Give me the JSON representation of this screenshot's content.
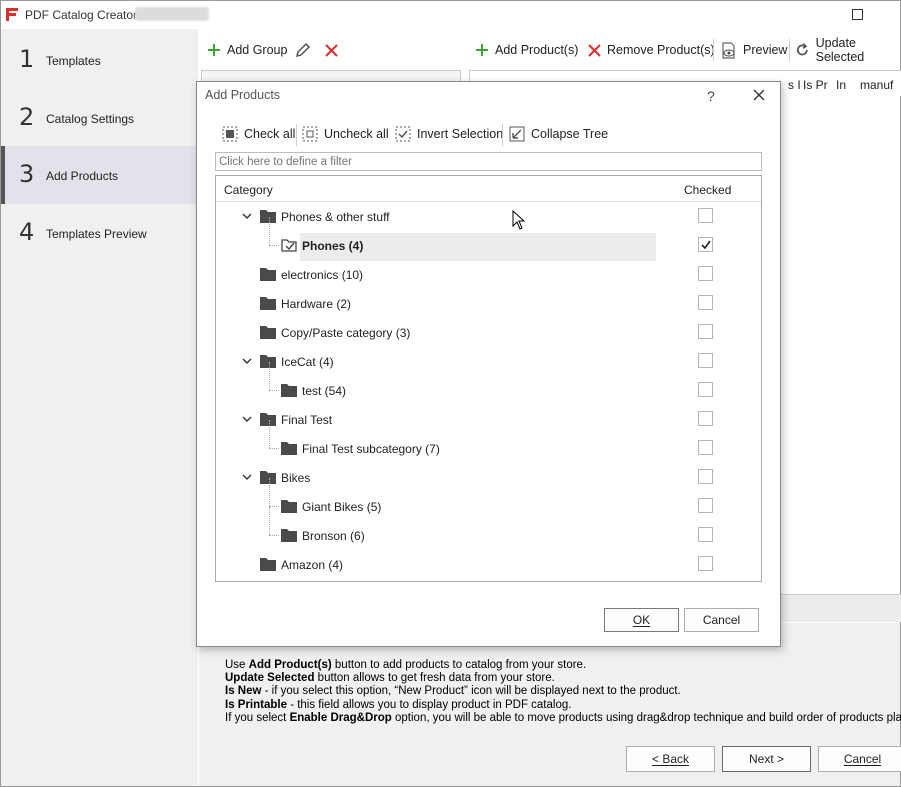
{
  "app": {
    "title": "PDF Catalog Creator"
  },
  "sidebar": {
    "items": [
      {
        "num": "1",
        "label": "Templates"
      },
      {
        "num": "2",
        "label": "Catalog Settings"
      },
      {
        "num": "3",
        "label": "Add Products"
      },
      {
        "num": "4",
        "label": "Templates Preview"
      }
    ],
    "active_index": 2
  },
  "toolbar": {
    "add_group": "Add Group",
    "add_products": "Add Product(s)",
    "remove_products": "Remove Product(s)",
    "preview": "Preview",
    "update_selected": "Update Selected"
  },
  "grid": {
    "columns": [
      "s I",
      "Is Pr",
      "In",
      "manuf"
    ]
  },
  "dialog": {
    "title": "Add Products",
    "help": "?",
    "toolbar": {
      "check_all": "Check all",
      "uncheck_all": "Uncheck all",
      "invert_selection": "Invert Selection",
      "collapse_tree": "Collapse Tree"
    },
    "filter_placeholder": "Click here to define a filter",
    "columns": {
      "category": "Category",
      "checked": "Checked"
    },
    "rows": [
      {
        "label": "Phones & other stuff",
        "level": 0,
        "expanded": true,
        "checked": false
      },
      {
        "label": "Phones (4)",
        "level": 1,
        "checked": true,
        "selected": true
      },
      {
        "label": "electronics (10)",
        "level": 0,
        "checked": false
      },
      {
        "label": "Hardware (2)",
        "level": 0,
        "checked": false
      },
      {
        "label": "Copy/Paste category (3)",
        "level": 0,
        "checked": false
      },
      {
        "label": "IceCat (4)",
        "level": 0,
        "expanded": true,
        "checked": false
      },
      {
        "label": "test (54)",
        "level": 1,
        "checked": false
      },
      {
        "label": "Final Test",
        "level": 0,
        "expanded": true,
        "checked": false
      },
      {
        "label": "Final Test subcategory (7)",
        "level": 1,
        "checked": false
      },
      {
        "label": "Bikes",
        "level": 0,
        "expanded": true,
        "checked": false
      },
      {
        "label": "Giant Bikes (5)",
        "level": 1,
        "checked": false
      },
      {
        "label": "Bronson (6)",
        "level": 1,
        "checked": false
      },
      {
        "label": "Amazon (4)",
        "level": 0,
        "checked": false
      }
    ],
    "ok": "OK",
    "cancel": "Cancel"
  },
  "info": {
    "line1": {
      "a": "Use ",
      "b": "Add Product(s)",
      "c": " button to add products to catalog from your store."
    },
    "line2": {
      "b": "Update Selected",
      "c": " button allows to get fresh data from your store."
    },
    "line3": {
      "b": "Is New",
      "c": " - if you select this option, “New Product” icon will be displayed next to the product."
    },
    "line4": {
      "b": "Is Printable",
      "c": " - this field allows you to display product in PDF catalog."
    },
    "line5": {
      "a": "If you select ",
      "b": "Enable Drag&Drop",
      "c": " option, you will be able to move products using drag&drop technique and build order of products placement"
    }
  },
  "wizard": {
    "back": "< Back",
    "next": "Next >",
    "cancel": "Cancel"
  },
  "colors": {
    "accent_red": "#d9302c",
    "accent_green": "#3aa33a",
    "folder": "#4a4a4a"
  }
}
